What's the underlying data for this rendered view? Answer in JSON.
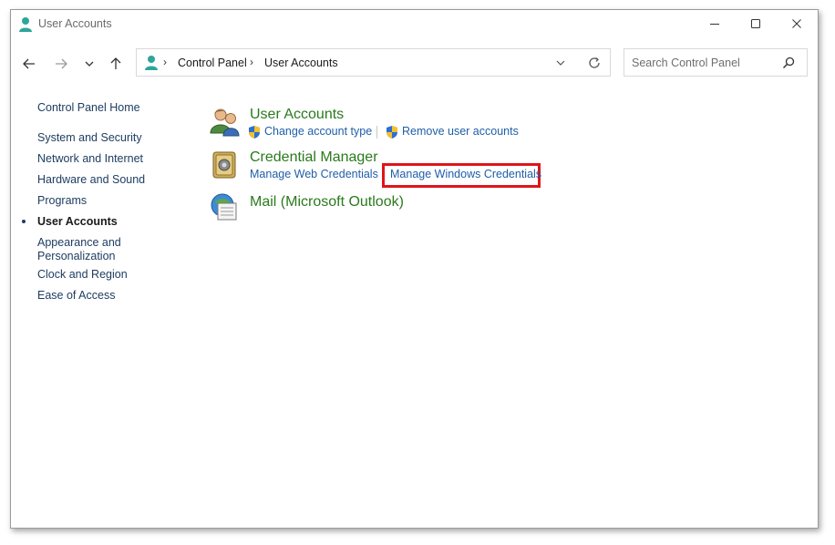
{
  "window": {
    "title": "User Accounts"
  },
  "address": {
    "crumbs": [
      "Control Panel",
      "User Accounts"
    ]
  },
  "search": {
    "placeholder": "Search Control Panel"
  },
  "sidebar": {
    "home": "Control Panel Home",
    "items": [
      {
        "label": "System and Security"
      },
      {
        "label": "Network and Internet"
      },
      {
        "label": "Hardware and Sound"
      },
      {
        "label": "Programs"
      },
      {
        "label": "User Accounts",
        "active": true
      },
      {
        "label": "Appearance and\nPersonalization"
      },
      {
        "label": "Clock and Region"
      },
      {
        "label": "Ease of Access"
      }
    ]
  },
  "main": {
    "categories": [
      {
        "title": "User Accounts",
        "icon": "users-icon",
        "links": [
          "Change account type",
          "Remove user accounts"
        ]
      },
      {
        "title": "Credential Manager",
        "icon": "credential-vault-icon",
        "links": [
          "Manage Web Credentials",
          "Manage Windows Credentials"
        ]
      },
      {
        "title": "Mail (Microsoft Outlook)",
        "icon": "mail-icon",
        "links": []
      }
    ],
    "highlight_color": "#e0141b"
  },
  "colors": {
    "category_title": "#2a7a1c",
    "link": "#1f5ea8",
    "sidebar_link": "#1e3d61"
  }
}
